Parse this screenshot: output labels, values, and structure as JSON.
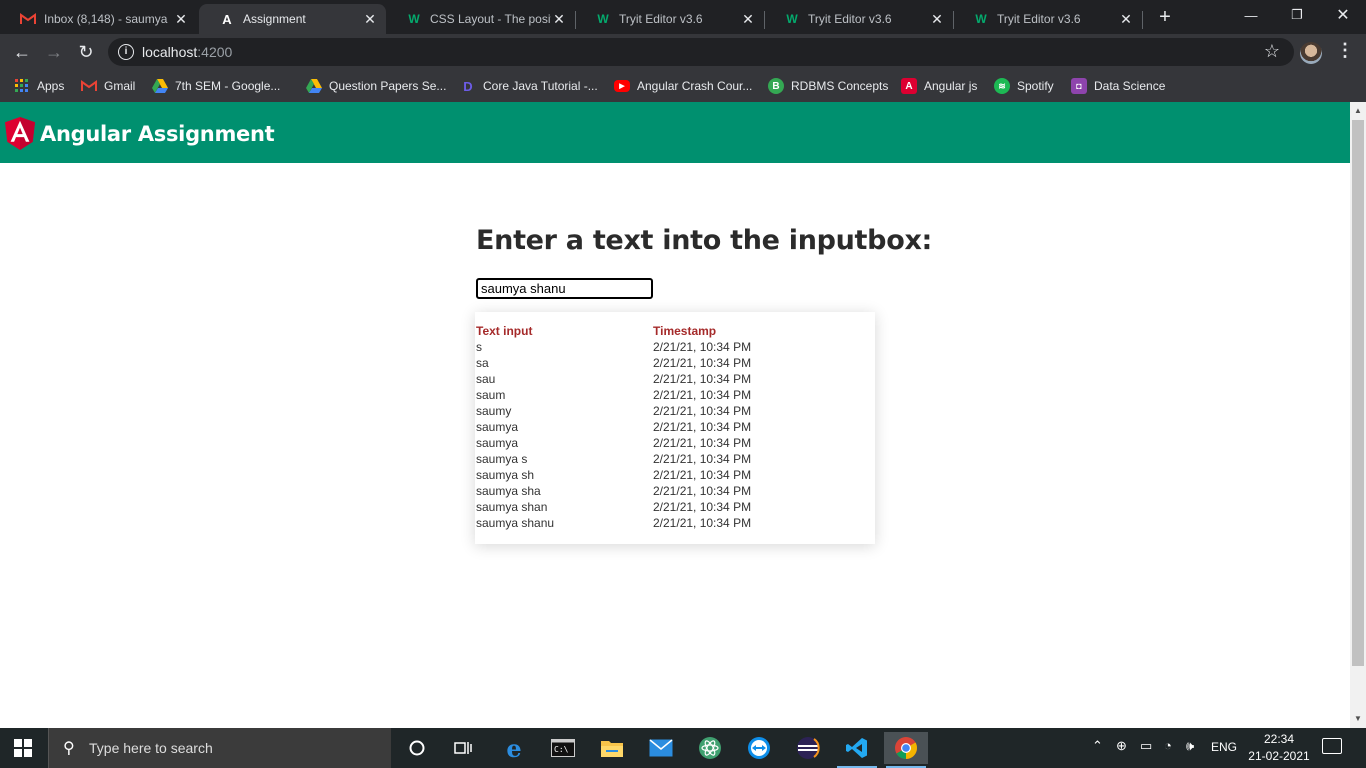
{
  "browser": {
    "tabs": [
      {
        "title": "Inbox (8,148) - saumya",
        "icon": "gmail-icon",
        "active": false
      },
      {
        "title": "Assignment",
        "icon": "angular-icon",
        "active": true
      },
      {
        "title": "CSS Layout - The positio",
        "icon": "w3schools-icon",
        "active": false
      },
      {
        "title": "Tryit Editor v3.6",
        "icon": "w3schools-icon",
        "active": false
      },
      {
        "title": "Tryit Editor v3.6",
        "icon": "w3schools-icon",
        "active": false
      },
      {
        "title": "Tryit Editor v3.6",
        "icon": "w3schools-icon",
        "active": false
      }
    ],
    "url_host": "localhost",
    "url_port": ":4200",
    "bookmarks": [
      {
        "label": "Apps",
        "icon": "apps-grid-icon"
      },
      {
        "label": "Gmail",
        "icon": "gmail-icon"
      },
      {
        "label": "7th SEM - Google...",
        "icon": "google-drive-icon"
      },
      {
        "label": "Question Papers Se...",
        "icon": "google-drive-icon"
      },
      {
        "label": "Core Java Tutorial -...",
        "icon": "dev-logo-icon"
      },
      {
        "label": "Angular Crash Cour...",
        "icon": "youtube-icon"
      },
      {
        "label": "RDBMS Concepts",
        "icon": "b-logo-icon"
      },
      {
        "label": "Angular js",
        "icon": "angular-icon"
      },
      {
        "label": "Spotify",
        "icon": "spotify-icon"
      },
      {
        "label": "Data Science",
        "icon": "person-badge-icon"
      }
    ]
  },
  "app": {
    "title": "Angular Assignment",
    "heading": "Enter a text into the inputbox:",
    "input_value": "saumya shanu",
    "table": {
      "headers": [
        "Text input",
        "Timestamp"
      ],
      "rows": [
        [
          "s",
          "2/21/21, 10:34 PM"
        ],
        [
          "sa",
          "2/21/21, 10:34 PM"
        ],
        [
          "sau",
          "2/21/21, 10:34 PM"
        ],
        [
          "saum",
          "2/21/21, 10:34 PM"
        ],
        [
          "saumy",
          "2/21/21, 10:34 PM"
        ],
        [
          "saumya",
          "2/21/21, 10:34 PM"
        ],
        [
          "saumya",
          "2/21/21, 10:34 PM"
        ],
        [
          "saumya s",
          "2/21/21, 10:34 PM"
        ],
        [
          "saumya sh",
          "2/21/21, 10:34 PM"
        ],
        [
          "saumya sha",
          "2/21/21, 10:34 PM"
        ],
        [
          "saumya shan",
          "2/21/21, 10:34 PM"
        ],
        [
          "saumya shanu",
          "2/21/21, 10:34 PM"
        ]
      ]
    },
    "colors": {
      "header_bar": "#00906f",
      "column_header": "#a52a2a"
    }
  },
  "taskbar": {
    "search_placeholder": "Type here to search",
    "language": "ENG",
    "time": "22:34",
    "date": "21-02-2021"
  }
}
